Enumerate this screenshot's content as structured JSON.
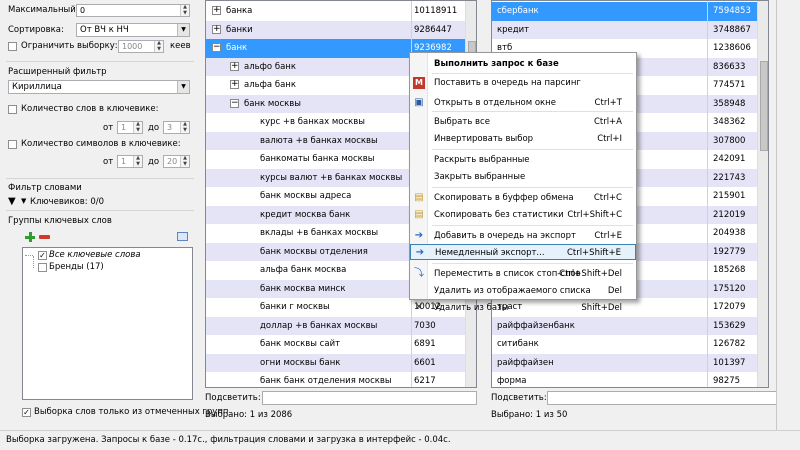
{
  "left": {
    "max_label": "Максимальный:",
    "max_value": "0",
    "sort_label": "Сортировка:",
    "sort_value": "От ВЧ к НЧ",
    "limit_label": "Ограничить выборку:",
    "limit_value": "1000",
    "limit_unit": "кеев",
    "ext_filter_title": "Расширенный фильтр",
    "charset_value": "Кириллица",
    "word_count_label": "Количество слов в ключевике:",
    "from_label": "от",
    "to_label": "до",
    "word_from": "1",
    "word_to": "3",
    "char_count_label": "Количество символов в ключевике:",
    "char_from": "1",
    "char_to": "20",
    "word_filter_title": "Фильтр словами",
    "keywords_count": "Ключевиков: 0/0",
    "groups_title": "Группы ключевых слов",
    "tree": [
      "Все ключевые слова",
      "Бренды (17)"
    ],
    "only_checked_label": "Выборка слов только из отмеченных групп"
  },
  "middle": {
    "rows": [
      {
        "text": "банка",
        "value": "10118911",
        "level": 0,
        "expander": "+"
      },
      {
        "text": "банки",
        "value": "9286447",
        "level": 0,
        "expander": "+"
      },
      {
        "text": "банк",
        "value": "9236982",
        "level": 0,
        "expander": "−"
      },
      {
        "text": "альфо банк",
        "value": "",
        "level": 1,
        "expander": "+"
      },
      {
        "text": "альфа банк",
        "value": "",
        "level": 1,
        "expander": "+"
      },
      {
        "text": "банк москвы",
        "value": "",
        "level": 1,
        "expander": "−"
      },
      {
        "text": "курс +в банках москвы",
        "value": "",
        "level": 2,
        "expander": ""
      },
      {
        "text": "валюта +в банках москвы",
        "value": "",
        "level": 2,
        "expander": ""
      },
      {
        "text": "банкоматы банка москвы",
        "value": "",
        "level": 2,
        "expander": ""
      },
      {
        "text": "курсы валют +в банках москвы",
        "value": "",
        "level": 2,
        "expander": ""
      },
      {
        "text": "банк москвы адреса",
        "value": "",
        "level": 2,
        "expander": ""
      },
      {
        "text": "кредит москва банк",
        "value": "",
        "level": 2,
        "expander": ""
      },
      {
        "text": "вклады +в банках москвы",
        "value": "",
        "level": 2,
        "expander": ""
      },
      {
        "text": "банк москвы отделения",
        "value": "",
        "level": 2,
        "expander": ""
      },
      {
        "text": "альфа банк москва",
        "value": "",
        "level": 2,
        "expander": ""
      },
      {
        "text": "банк москва минск",
        "value": "",
        "level": 2,
        "expander": ""
      },
      {
        "text": "банки г москвы",
        "value": "10012",
        "level": 2,
        "expander": ""
      },
      {
        "text": "доллар +в банках москвы",
        "value": "7030",
        "level": 2,
        "expander": ""
      },
      {
        "text": "банк москвы сайт",
        "value": "6891",
        "level": 2,
        "expander": ""
      },
      {
        "text": "огни москвы банк",
        "value": "6601",
        "level": 2,
        "expander": ""
      },
      {
        "text": "банк банк отделения москвы",
        "value": "6217",
        "level": 2,
        "expander": ""
      }
    ],
    "filter_label": "Подсветить:",
    "selected_info": "Выбрано: 1 из 2086"
  },
  "right": {
    "rows": [
      {
        "text": "сбербанк",
        "value": "7594853"
      },
      {
        "text": "кредит",
        "value": "3748867"
      },
      {
        "text": "втб",
        "value": "1238606"
      },
      {
        "text": "",
        "value": "836633"
      },
      {
        "text": "",
        "value": "774571"
      },
      {
        "text": "",
        "value": "358948"
      },
      {
        "text": "",
        "value": "348362"
      },
      {
        "text": "",
        "value": "307800"
      },
      {
        "text": "",
        "value": "242091"
      },
      {
        "text": "",
        "value": "221743"
      },
      {
        "text": "",
        "value": "215901"
      },
      {
        "text": "",
        "value": "212019"
      },
      {
        "text": "",
        "value": "204938"
      },
      {
        "text": "",
        "value": "192779"
      },
      {
        "text": "",
        "value": "185268"
      },
      {
        "text": "",
        "value": "175120"
      },
      {
        "text": "траст",
        "value": "172079"
      },
      {
        "text": "райффайзенбанк",
        "value": "153629"
      },
      {
        "text": "ситибанк",
        "value": "126782"
      },
      {
        "text": "райффайзен",
        "value": "101397"
      },
      {
        "text": "форма",
        "value": "98275"
      }
    ],
    "filter_label": "Подсветить:",
    "selected_info": "Выбрано: 1 из 50"
  },
  "context_menu": {
    "title": "Выполнить запрос к базе",
    "items": [
      {
        "label": "Поставить в очередь на парсинг",
        "shortcut": "",
        "icon": "parse-queue-icon"
      },
      {
        "label": "Открыть в отдельном окне",
        "shortcut": "Ctrl+T",
        "icon": "new-window-icon"
      },
      {
        "label": "Выбрать все",
        "shortcut": "Ctrl+A",
        "icon": ""
      },
      {
        "label": "Инвертировать выбор",
        "shortcut": "Ctrl+I",
        "icon": ""
      },
      {
        "label": "Раскрыть выбранные",
        "shortcut": "",
        "icon": ""
      },
      {
        "label": "Закрыть выбранные",
        "shortcut": "",
        "icon": ""
      },
      {
        "label": "Скопировать в буффер обмена",
        "shortcut": "Ctrl+C",
        "icon": "clipboard-icon"
      },
      {
        "label": "Скопировать без статистики",
        "shortcut": "Ctrl+Shift+C",
        "icon": "clipboard-icon"
      },
      {
        "label": "Добавить в очередь на экспорт",
        "shortcut": "Ctrl+E",
        "icon": "arrow-right-icon"
      },
      {
        "label": "Немедленный экспорт...",
        "shortcut": "Ctrl+Shift+E",
        "icon": "arrow-right-icon"
      },
      {
        "label": "Переместить в список стоп-слов",
        "shortcut": "Ctrl+Shift+Del",
        "icon": "move-stopwords-icon"
      },
      {
        "label": "Удалить из отображаемого списка",
        "shortcut": "Del",
        "icon": ""
      },
      {
        "label": "Удалить из базы",
        "shortcut": "Shift+Del",
        "icon": "x-icon"
      }
    ]
  },
  "status_text": "Выборка загружена. Запросы к базе - 0.17с., фильтрация словами и загрузка в интерфейс - 0.04с.",
  "colors": {
    "selection": "#3399ff",
    "alt_row": "#e4e4f6",
    "menu_highlight": "#e5f1fb"
  }
}
